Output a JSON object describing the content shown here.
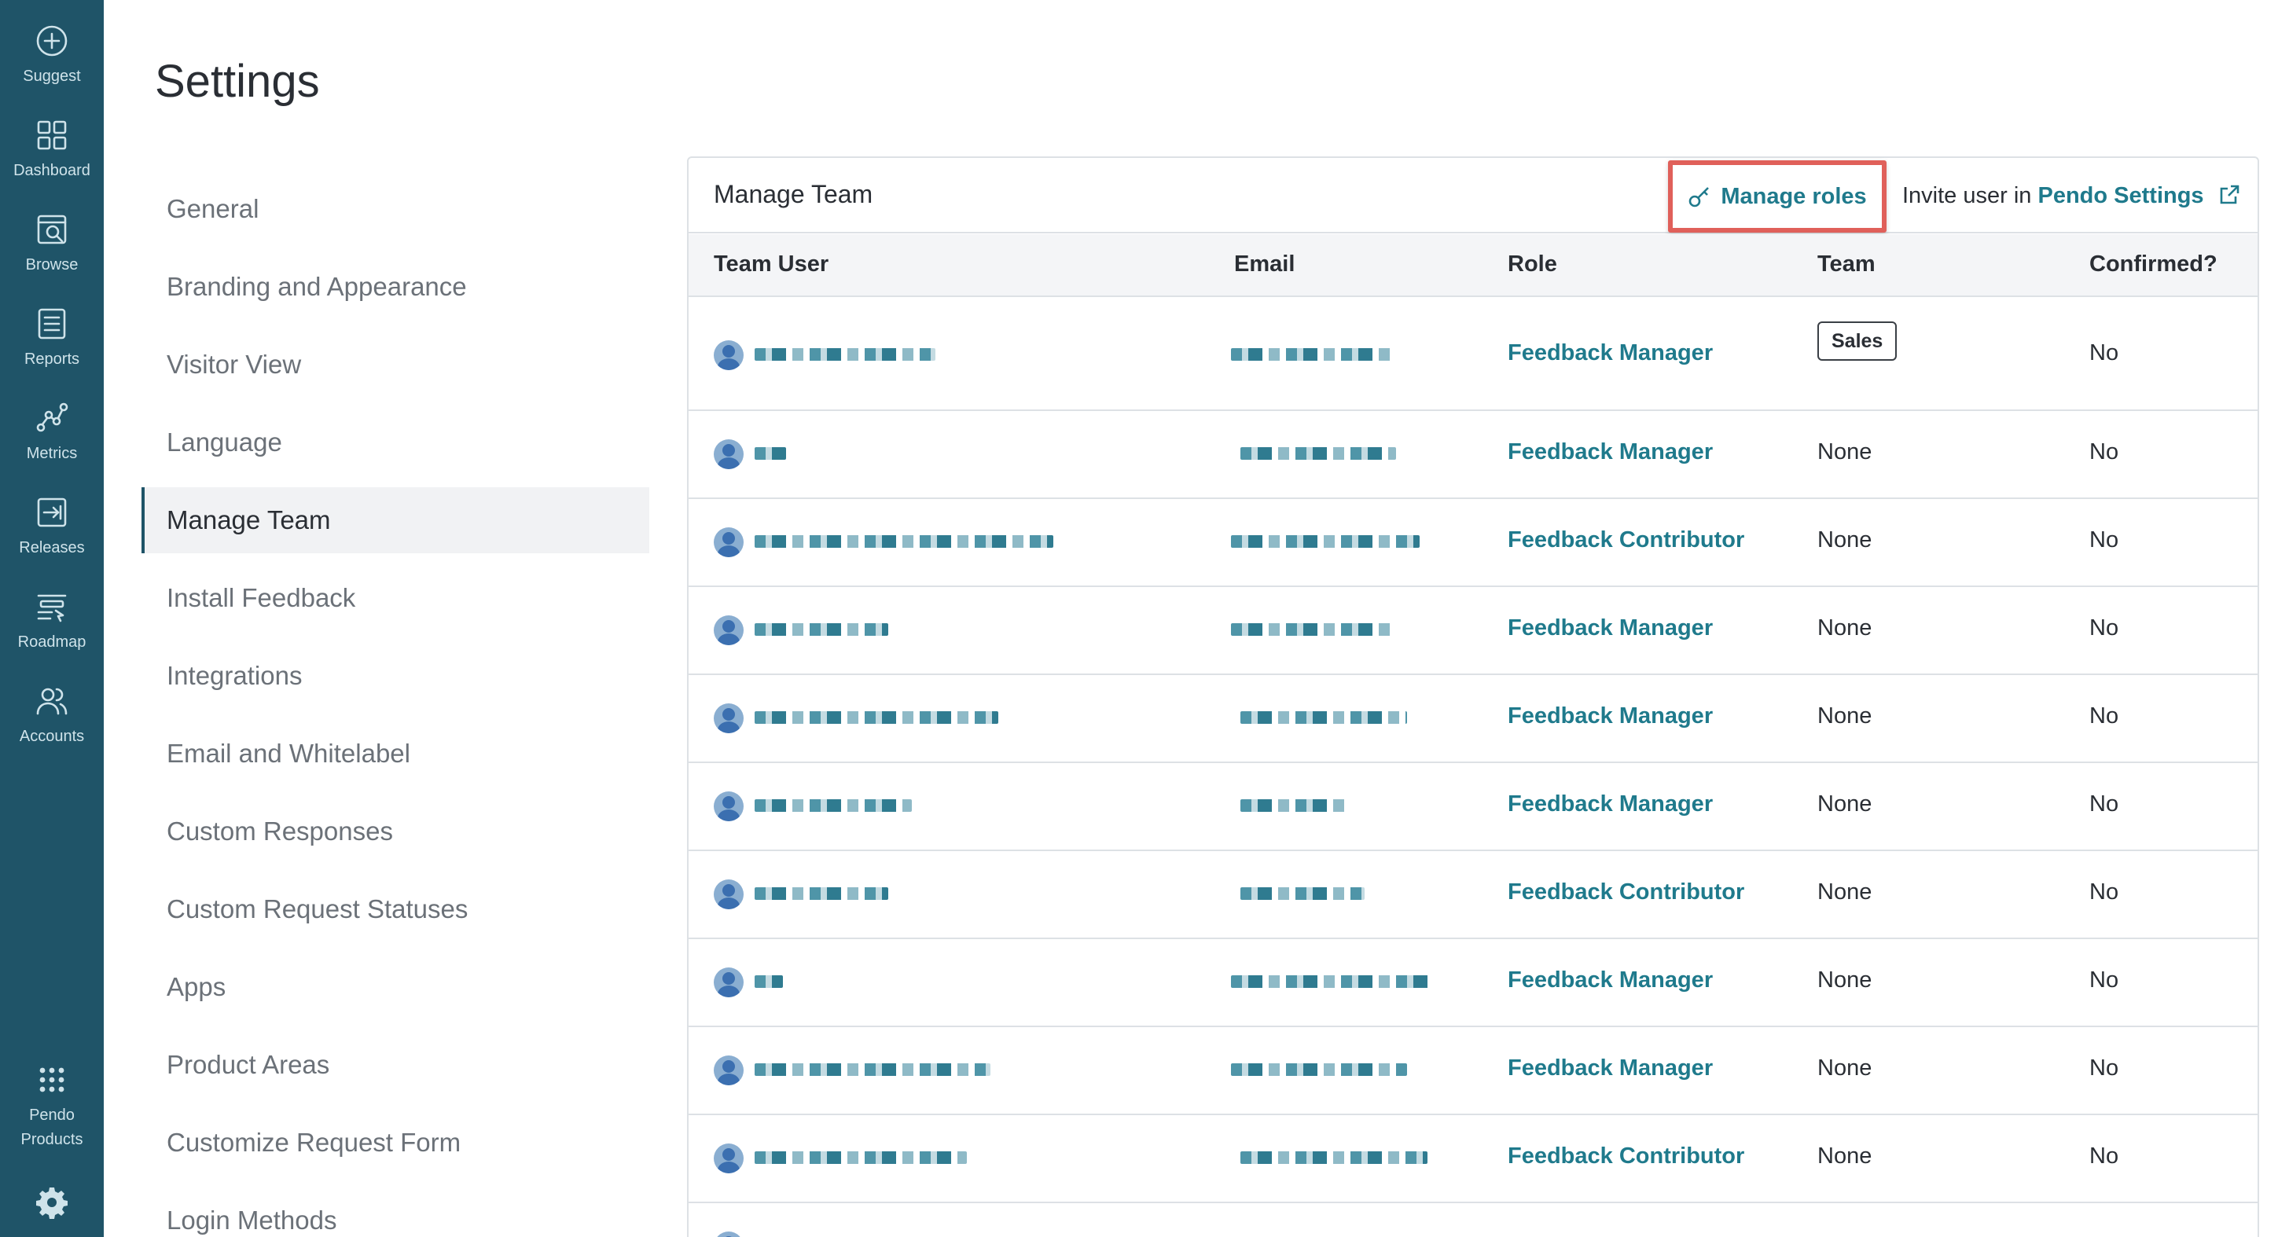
{
  "rail": {
    "items": [
      {
        "label": "Suggest",
        "icon": "plus-circle-icon"
      },
      {
        "label": "Dashboard",
        "icon": "grid-icon"
      },
      {
        "label": "Browse",
        "icon": "browse-icon"
      },
      {
        "label": "Reports",
        "icon": "reports-icon"
      },
      {
        "label": "Metrics",
        "icon": "metrics-icon"
      },
      {
        "label": "Releases",
        "icon": "releases-icon"
      },
      {
        "label": "Roadmap",
        "icon": "roadmap-icon"
      },
      {
        "label": "Accounts",
        "icon": "accounts-icon"
      }
    ],
    "products_label": "Pendo Products",
    "settings_icon": "gear-icon"
  },
  "page": {
    "title": "Settings"
  },
  "settings_nav": {
    "items": [
      "General",
      "Branding and Appearance",
      "Visitor View",
      "Language",
      "Manage Team",
      "Install Feedback",
      "Integrations",
      "Email and Whitelabel",
      "Custom Responses",
      "Custom Request Statuses",
      "Apps",
      "Product Areas",
      "Customize Request Form",
      "Login Methods"
    ],
    "active": "Manage Team"
  },
  "panel": {
    "title": "Manage Team",
    "manage_roles_label": "Manage roles",
    "invite_prefix": "Invite user in",
    "invite_link": "Pendo Settings",
    "columns": [
      "Team User",
      "Email",
      "Role",
      "Team",
      "Confirmed?"
    ],
    "rows": [
      {
        "role": "Feedback Manager",
        "team": "Sales",
        "team_is_badge": true,
        "confirmed": "No"
      },
      {
        "role": "Feedback Manager",
        "team": "None",
        "confirmed": "No"
      },
      {
        "role": "Feedback Contributor",
        "team": "None",
        "confirmed": "No"
      },
      {
        "role": "Feedback Manager",
        "team": "None",
        "confirmed": "No"
      },
      {
        "role": "Feedback Manager",
        "team": "None",
        "confirmed": "No"
      },
      {
        "role": "Feedback Manager",
        "team": "None",
        "confirmed": "No"
      },
      {
        "role": "Feedback Contributor",
        "team": "None",
        "confirmed": "No"
      },
      {
        "role": "Feedback Manager",
        "team": "None",
        "confirmed": "No"
      },
      {
        "role": "Feedback Manager",
        "team": "None",
        "confirmed": "No"
      },
      {
        "role": "Feedback Contributor",
        "team": "None",
        "confirmed": "No"
      }
    ]
  },
  "colors": {
    "rail_bg": "#1f5468",
    "link": "#1f7a8c",
    "highlight_border": "#e0605a"
  }
}
